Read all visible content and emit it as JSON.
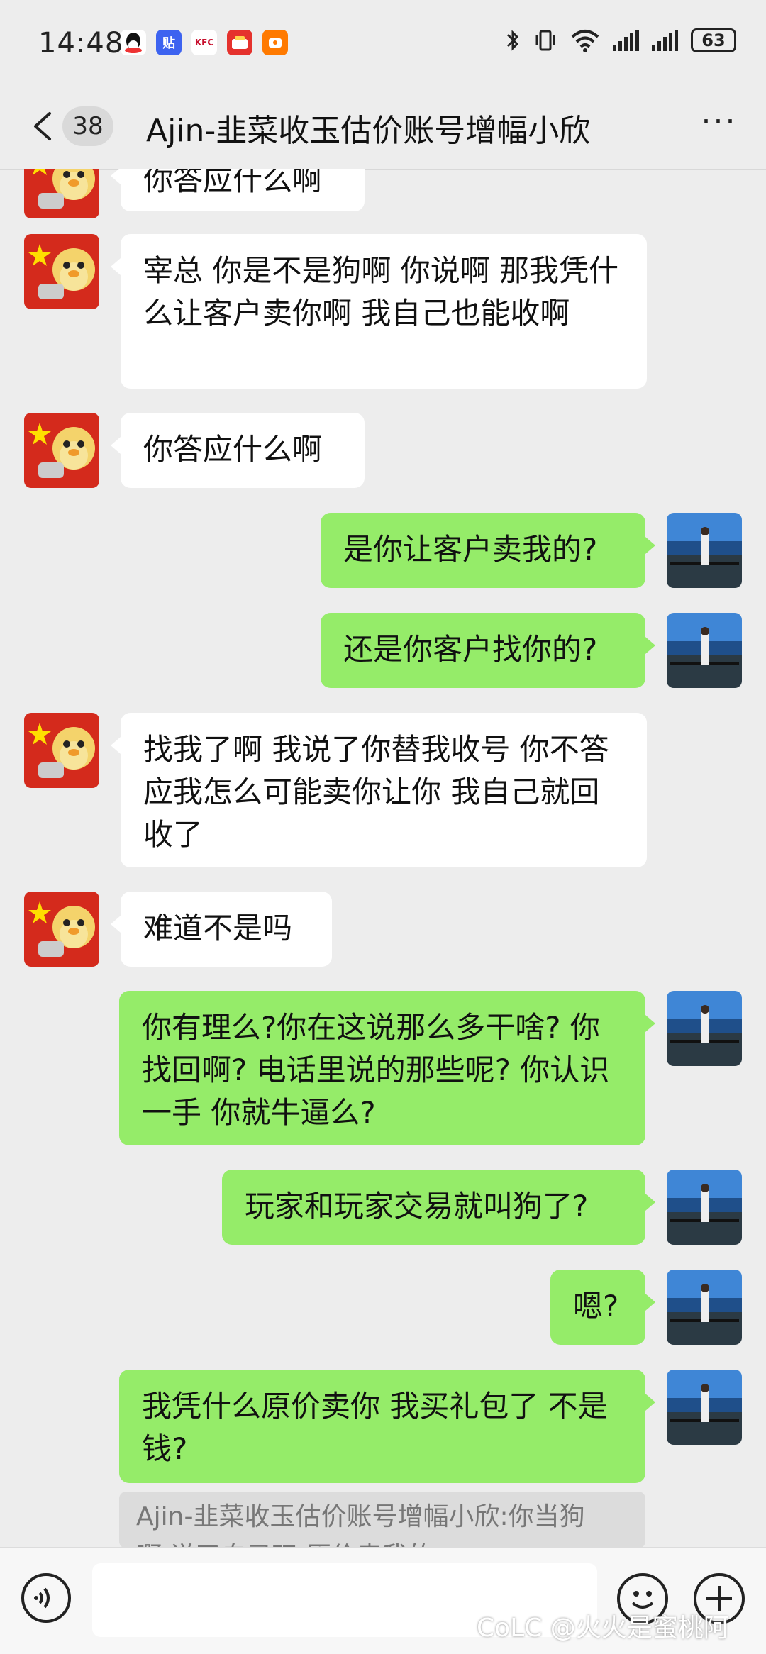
{
  "status_bar": {
    "time": "14:48",
    "battery": "63",
    "app_icons": [
      "qq-icon",
      "tieba-icon",
      "kfc-icon",
      "waimai-icon",
      "orange-app-icon"
    ],
    "status_icons": [
      "bluetooth-icon",
      "vibrate-icon",
      "wifi-icon",
      "signal-icon",
      "signal-icon"
    ]
  },
  "header": {
    "unread_count": "38",
    "title": "Ajin-韭菜收玉估价账号增幅小欣",
    "more_label": "···"
  },
  "colors": {
    "background": "#ededed",
    "bubble_self": "#95ec69",
    "bubble_other": "#ffffff"
  },
  "messages": [
    {
      "side": "left",
      "text": "你答应什么啊"
    },
    {
      "side": "left",
      "text": "宰总 你是不是狗啊 你说啊 那我凭什么让客户卖你啊 我自己也能收啊"
    },
    {
      "side": "left",
      "text": "你答应什么啊"
    },
    {
      "side": "right",
      "text": "是你让客户卖我的?"
    },
    {
      "side": "right",
      "text": "还是你客户找你的?"
    },
    {
      "side": "left",
      "text": "找我了啊 我说了你替我收号 你不答应我怎么可能卖你让你 我自己就回收了"
    },
    {
      "side": "left",
      "text": "难道不是吗"
    },
    {
      "side": "right",
      "text": "你有理么?你在这说那么多干啥? 你找回啊? 电话里说的那些呢? 你认识一手 你就牛逼么?"
    },
    {
      "side": "right",
      "text": "玩家和玩家交易就叫狗了?"
    },
    {
      "side": "right",
      "text": "嗯?"
    },
    {
      "side": "right",
      "text": "我凭什么原价卖你 我买礼包了 不是钱?"
    }
  ],
  "quote": {
    "line1": "Ajin-韭菜收玉估价账号增幅小欣:你当狗",
    "line2": "啊 说了自己玩 原价卖我的"
  },
  "input_bar": {
    "input_value": "",
    "watermark": "CoLC @火火是蜜桃阿"
  }
}
